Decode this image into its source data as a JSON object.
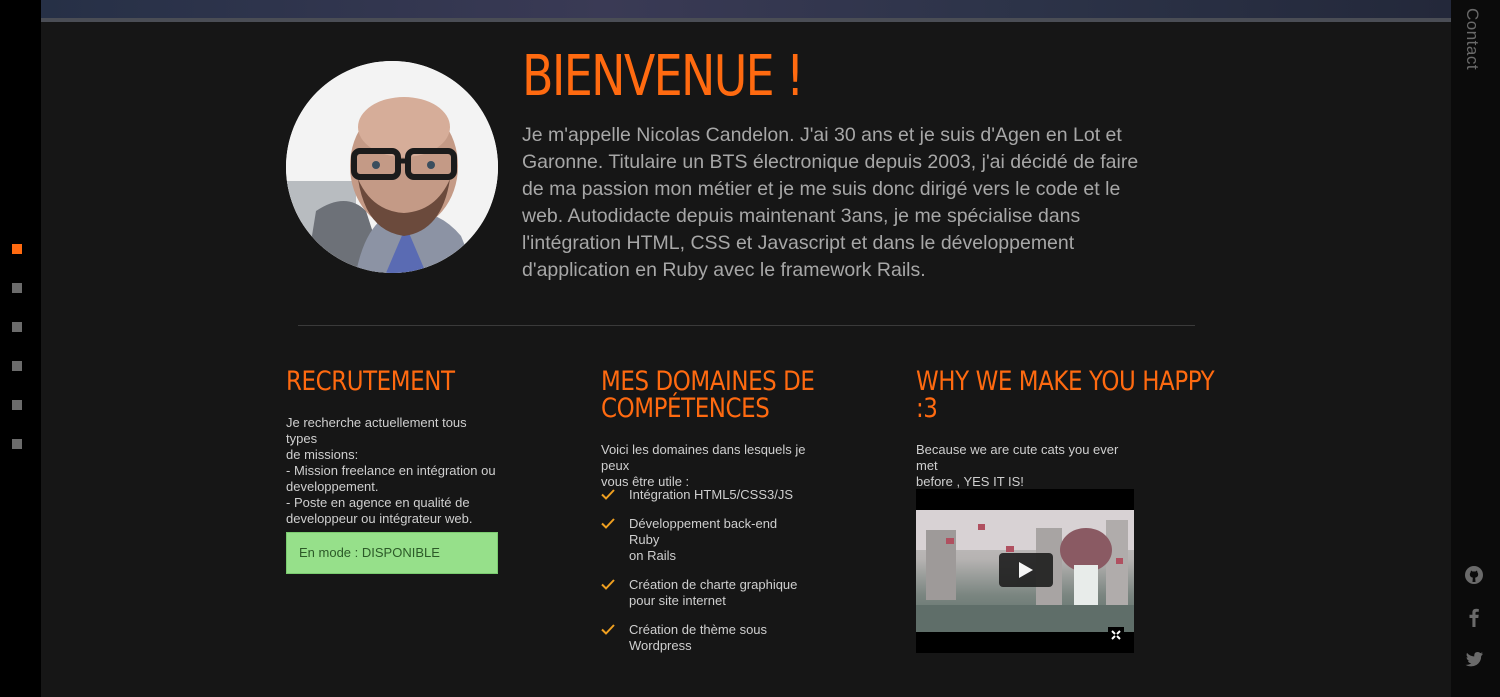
{
  "sidebar": {
    "nav_dots": [
      "active",
      "inactive",
      "inactive",
      "inactive",
      "inactive",
      "inactive"
    ]
  },
  "contact_tab": {
    "label": "Contact"
  },
  "hero": {
    "title": "BIENVENUE !",
    "text": "Je m'appelle Nicolas Candelon. J'ai 30 ans et je suis d'Agen en Lot et Garonne. Titulaire un BTS électronique depuis 2003, j'ai décidé de faire de ma passion mon métier et je me suis donc dirigé vers le code et le web. Autodidacte depuis maintenant 3ans, je me spécialise dans l'intégration HTML, CSS et Javascript et dans le développement d'application en Ruby avec le framework Rails."
  },
  "recrutement": {
    "title": "RECRUTEMENT",
    "lines": [
      "Je recherche actuellement tous types",
      "de missions:",
      "- Mission freelance en intégration ou",
      "developpement.",
      "- Poste en agence en qualité de",
      "developpeur ou intégrateur web."
    ],
    "status": "En mode : DISPONIBLE"
  },
  "competences": {
    "title_lines": [
      "MES DOMAINES DE",
      "COMPÉTENCES"
    ],
    "intro_lines": [
      "Voici les domaines dans lesquels je peux",
      "vous être utile :"
    ],
    "items": [
      [
        "Intégration HTML5/CSS3/JS"
      ],
      [
        "Développement back-end Ruby",
        "on Rails"
      ],
      [
        "Création de charte graphique",
        "pour site internet"
      ],
      [
        "Création de thème sous",
        "Wordpress"
      ]
    ]
  },
  "happy": {
    "title_lines": [
      "WHY WE MAKE YOU HAPPY",
      ":3"
    ],
    "text_lines": [
      "Because we are cute cats you ever met",
      "before , YES IT IS!"
    ]
  },
  "social": {
    "icons": [
      "github-icon",
      "facebook-icon",
      "twitter-icon"
    ]
  },
  "colors": {
    "accent": "#ff6a10",
    "status_bg": "#96e08a",
    "background": "#161616"
  }
}
